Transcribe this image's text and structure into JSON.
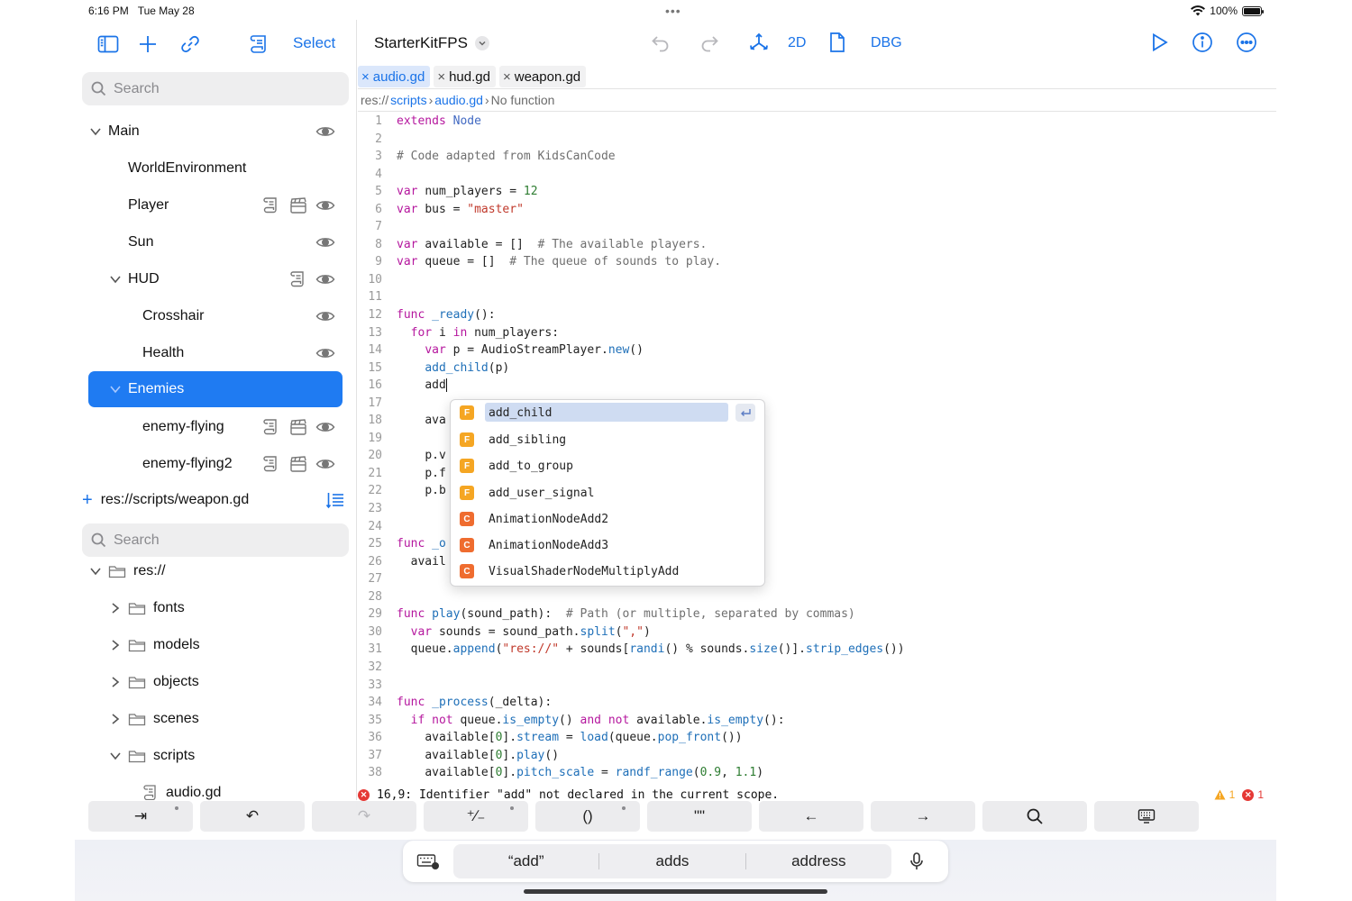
{
  "status_bar": {
    "time": "6:16 PM",
    "date": "Tue May 28",
    "battery": "100%",
    "battery_level": 1.0,
    "top_dots": "•••"
  },
  "sidebar": {
    "select_label": "Select",
    "search_placeholder": "Search",
    "scene_tree": [
      {
        "label": "Main"
      },
      {
        "label": "WorldEnvironment"
      },
      {
        "label": "Player"
      },
      {
        "label": "Sun"
      },
      {
        "label": "HUD"
      },
      {
        "label": "Crosshair"
      },
      {
        "label": "Health"
      },
      {
        "label": "Enemies"
      },
      {
        "label": "enemy-flying"
      },
      {
        "label": "enemy-flying2"
      }
    ],
    "open_file": "res://scripts/weapon.gd",
    "file_search_placeholder": "Search",
    "file_tree": [
      {
        "label": "res://"
      },
      {
        "label": "fonts"
      },
      {
        "label": "models"
      },
      {
        "label": "objects"
      },
      {
        "label": "scenes"
      },
      {
        "label": "scripts"
      },
      {
        "label": "audio.gd"
      }
    ]
  },
  "editor": {
    "project_name": "StarterKitFPS",
    "mode_2d": "2D",
    "debug": "DBG",
    "tabs": [
      {
        "label": "audio.gd",
        "active": true
      },
      {
        "label": "hud.gd",
        "active": false
      },
      {
        "label": "weapon.gd",
        "active": false
      }
    ],
    "breadcrumb": {
      "root": "res://",
      "folder": "scripts",
      "file": "audio.gd",
      "func": "No function"
    },
    "code_lines": [
      "1",
      "2",
      "3",
      "4",
      "5",
      "6",
      "7",
      "8",
      "9",
      "10",
      "11",
      "12",
      "13",
      "14",
      "15",
      "16",
      "17",
      "18",
      "19",
      "20",
      "21",
      "22",
      "23",
      "24",
      "25",
      "26",
      "27",
      "28",
      "29",
      "30",
      "31",
      "32",
      "33",
      "34",
      "35",
      "36",
      "37",
      "38"
    ],
    "code": {
      "l1a": "extends",
      "l1b": "Node",
      "l3": "# Code adapted from KidsCanCode",
      "l5a": "var",
      "l5b": "num_players = ",
      "l5c": "12",
      "l6a": "var",
      "l6b": "bus = ",
      "l6c": "\"master\"",
      "l8a": "var",
      "l8b": "available = []  ",
      "l8c": "# The available players.",
      "l9a": "var",
      "l9b": "queue = []  ",
      "l9c": "# The queue of sounds to play.",
      "l12a": "func",
      "l12b": "_ready",
      "l12c": "():",
      "l13a": "for",
      "l13b": " i ",
      "l13c": "in",
      "l13d": " num_players:",
      "l14a": "var",
      "l14b": " p = AudioStreamPlayer.",
      "l14c": "new",
      "l14d": "()",
      "l15a": "add_child",
      "l15b": "(p)",
      "l16": "add",
      "l18": "ava",
      "l20": "p.v",
      "l21a": "p.f",
      "l21b": "))",
      "l22": "p.b",
      "l25a": "func",
      "l25b": "_o",
      "l26": "avail",
      "l29a": "func",
      "l29b": "play",
      "l29c": "(sound_path):  ",
      "l29d": "# Path (or multiple, separated by commas)",
      "l30a": "var",
      "l30b": " sounds = sound_path.",
      "l30c": "split",
      "l30d": "(",
      "l30e": "\",\"",
      "l30f": ")",
      "l31a": "queue.",
      "l31b": "append",
      "l31c": "(",
      "l31d": "\"res://\"",
      "l31e": " + sounds[",
      "l31f": "randi",
      "l31g": "() % sounds.",
      "l31h": "size",
      "l31i": "()].",
      "l31j": "strip_edges",
      "l31k": "())",
      "l34a": "func",
      "l34b": "_process",
      "l34c": "(_delta):",
      "l35a": "if not",
      "l35b": " queue.",
      "l35c": "is_empty",
      "l35d": "() ",
      "l35e": "and not",
      "l35f": " available.",
      "l35g": "is_empty",
      "l35h": "():",
      "l36a": "available[",
      "l36b": "0",
      "l36c": "].",
      "l36d": "stream",
      "l36e": " = ",
      "l36f": "load",
      "l36g": "(queue.",
      "l36h": "pop_front",
      "l36i": "())",
      "l37a": "available[",
      "l37b": "0",
      "l37c": "].",
      "l37d": "play",
      "l37e": "()",
      "l38a": "available[",
      "l38b": "0",
      "l38c": "].",
      "l38d": "pitch_scale",
      "l38e": " = ",
      "l38f": "randf_range",
      "l38g": "(",
      "l38h": "0.9",
      "l38i": ", ",
      "l38j": "1.1",
      "l38k": ")"
    },
    "autocomplete": [
      {
        "badge": "F",
        "label": "add_child",
        "color": "#f5a623"
      },
      {
        "badge": "F",
        "label": "add_sibling",
        "color": "#f5a623"
      },
      {
        "badge": "F",
        "label": "add_to_group",
        "color": "#f5a623"
      },
      {
        "badge": "F",
        "label": "add_user_signal",
        "color": "#f5a623"
      },
      {
        "badge": "C",
        "label": "AnimationNodeAdd2",
        "color": "#ef6c2f"
      },
      {
        "badge": "C",
        "label": "AnimationNodeAdd3",
        "color": "#ef6c2f"
      },
      {
        "badge": "C",
        "label": "VisualShaderNodeMultiplyAdd",
        "color": "#ef6c2f"
      }
    ],
    "error_message": "16,9: Identifier \"add\" not declared in the current scope.",
    "warning_count": "1",
    "error_count": "1"
  },
  "keyboard_bar": {
    "keys": [
      {
        "label": "⇥",
        "name": "tab-key"
      },
      {
        "label": "↶",
        "name": "undo-key"
      },
      {
        "label": "↷",
        "name": "redo-key"
      },
      {
        "label": "⁺∕₋",
        "name": "plus-minus-key"
      },
      {
        "label": "()",
        "name": "parentheses-key"
      },
      {
        "label": "\"\"",
        "name": "quotes-key"
      },
      {
        "label": "←",
        "name": "left-arrow-key"
      },
      {
        "label": "→",
        "name": "right-arrow-key"
      }
    ]
  },
  "predictions": [
    "“add”",
    "adds",
    "address"
  ],
  "colors": {
    "accent": "#1a73e8",
    "selection": "#1f7bf2",
    "keyword": "#b5179e",
    "string": "#c0392b",
    "error": "#e53935",
    "warning": "#f5a623"
  }
}
